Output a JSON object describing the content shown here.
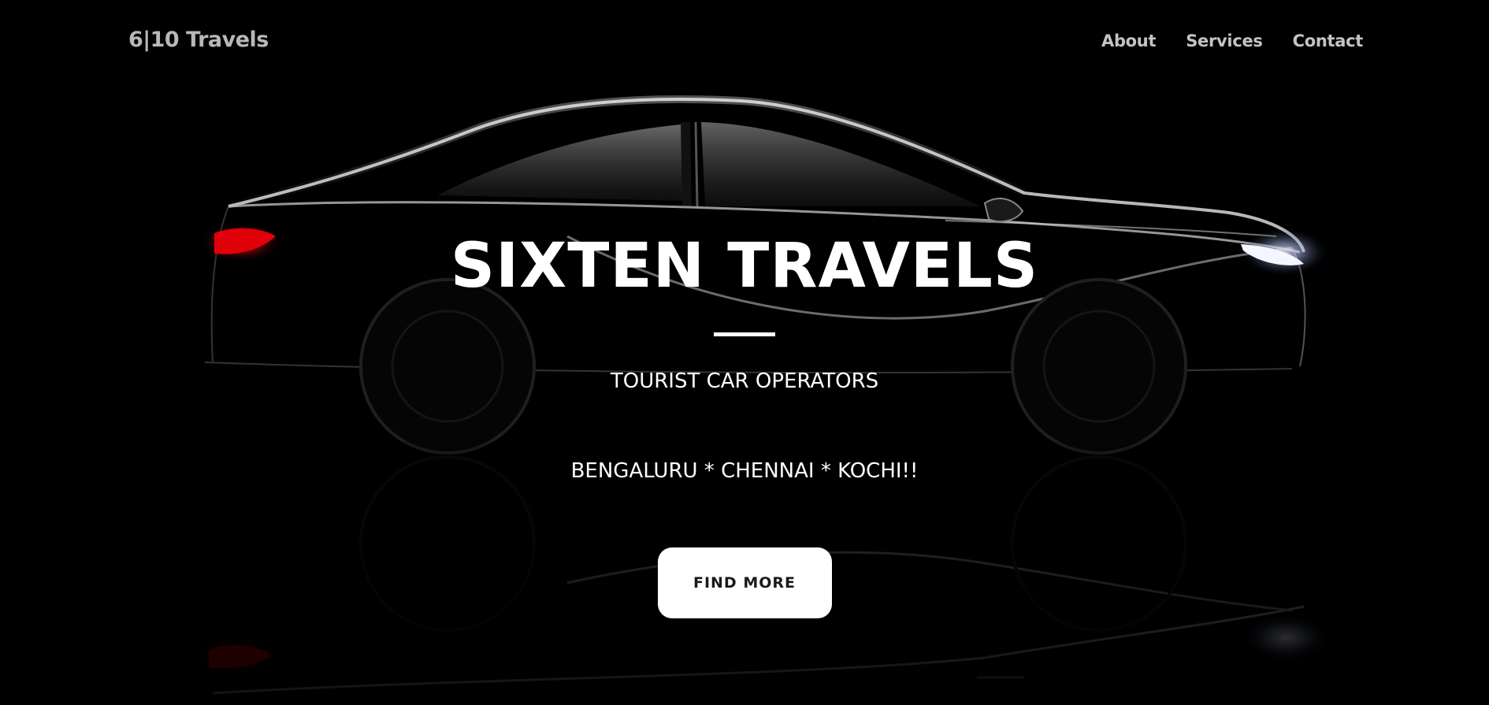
{
  "navbar": {
    "brand": "6|10 Travels",
    "links": [
      {
        "label": "About"
      },
      {
        "label": "Services"
      },
      {
        "label": "Contact"
      }
    ]
  },
  "hero": {
    "title": "SIXTEN TRAVELS",
    "subtitle": "TOURIST CAR OPERATORS",
    "cities": "BENGALURU * CHENNAI * KOCHI!!",
    "cta_label": "FIND MORE",
    "background_image": "black-car-silhouette"
  },
  "colors": {
    "background": "#000000",
    "text": "#ffffff",
    "nav_text": "#c4c4c4",
    "brand_text": "#b8b8b8",
    "tail_light": "#e0000a",
    "head_light": "#cfe0ff",
    "button_bg": "#ffffff",
    "button_text": "#1a1a1a"
  }
}
